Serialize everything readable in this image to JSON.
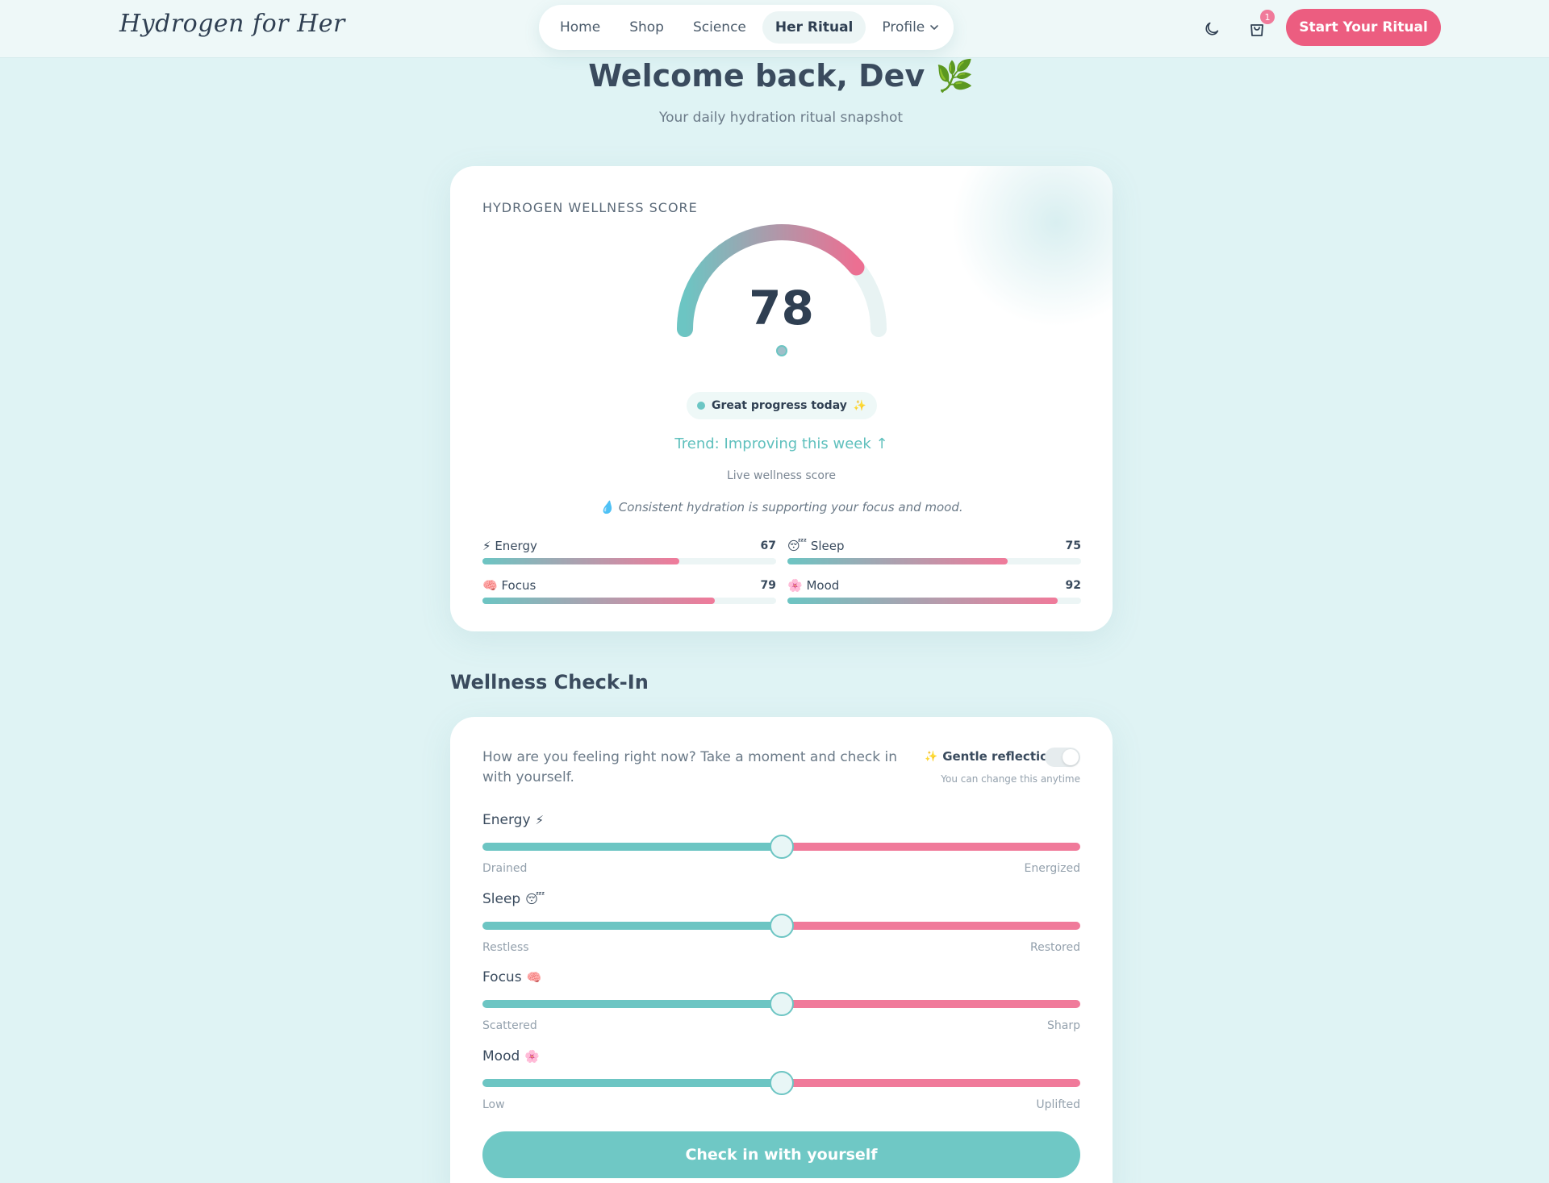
{
  "header": {
    "logo": "Hydrogen for Her",
    "nav": [
      {
        "label": "Home"
      },
      {
        "label": "Shop"
      },
      {
        "label": "Science"
      },
      {
        "label": "Her Ritual",
        "active": true
      },
      {
        "label": "Profile"
      }
    ],
    "cart_count": "1",
    "cta": "Start Your Ritual"
  },
  "hero": {
    "title": "Welcome back, Dev 🌿",
    "subtitle": "Your daily hydration ritual snapshot"
  },
  "score": {
    "label": "HYDROGEN WELLNESS SCORE",
    "value": "78",
    "value_num": 78,
    "status": "Great progress today",
    "trend": "Trend: Improving this week ↑",
    "live": "Live wellness score",
    "note": "💧 Consistent hydration is supporting your focus and mood.",
    "metrics": [
      {
        "icon": "⚡",
        "name": "Energy",
        "value": "67",
        "pct": 67
      },
      {
        "icon": "😴",
        "name": "Sleep",
        "value": "75",
        "pct": 75
      },
      {
        "icon": "🧠",
        "name": "Focus",
        "value": "79",
        "pct": 79
      },
      {
        "icon": "🌸",
        "name": "Mood",
        "value": "92",
        "pct": 92
      }
    ],
    "colors": {
      "teal": "#6cc5c3",
      "pink": "#f07a9a"
    }
  },
  "checkin": {
    "title": "Wellness Check-In",
    "question": "How are you feeling right now? Take a moment and check in with yourself.",
    "gentle_label": "Gentle reflection",
    "gentle_note": "You can change this anytime",
    "sliders": [
      {
        "label": "Energy",
        "emoji": "⚡",
        "low": "Drained",
        "high": "Energized",
        "value": 50
      },
      {
        "label": "Sleep",
        "emoji": "😴",
        "low": "Restless",
        "high": "Restored",
        "value": 50
      },
      {
        "label": "Focus",
        "emoji": "🧠",
        "low": "Scattered",
        "high": "Sharp",
        "value": 50
      },
      {
        "label": "Mood",
        "emoji": "🌸",
        "low": "Low",
        "high": "Uplifted",
        "value": 50
      }
    ],
    "button": "Check in with yourself"
  }
}
